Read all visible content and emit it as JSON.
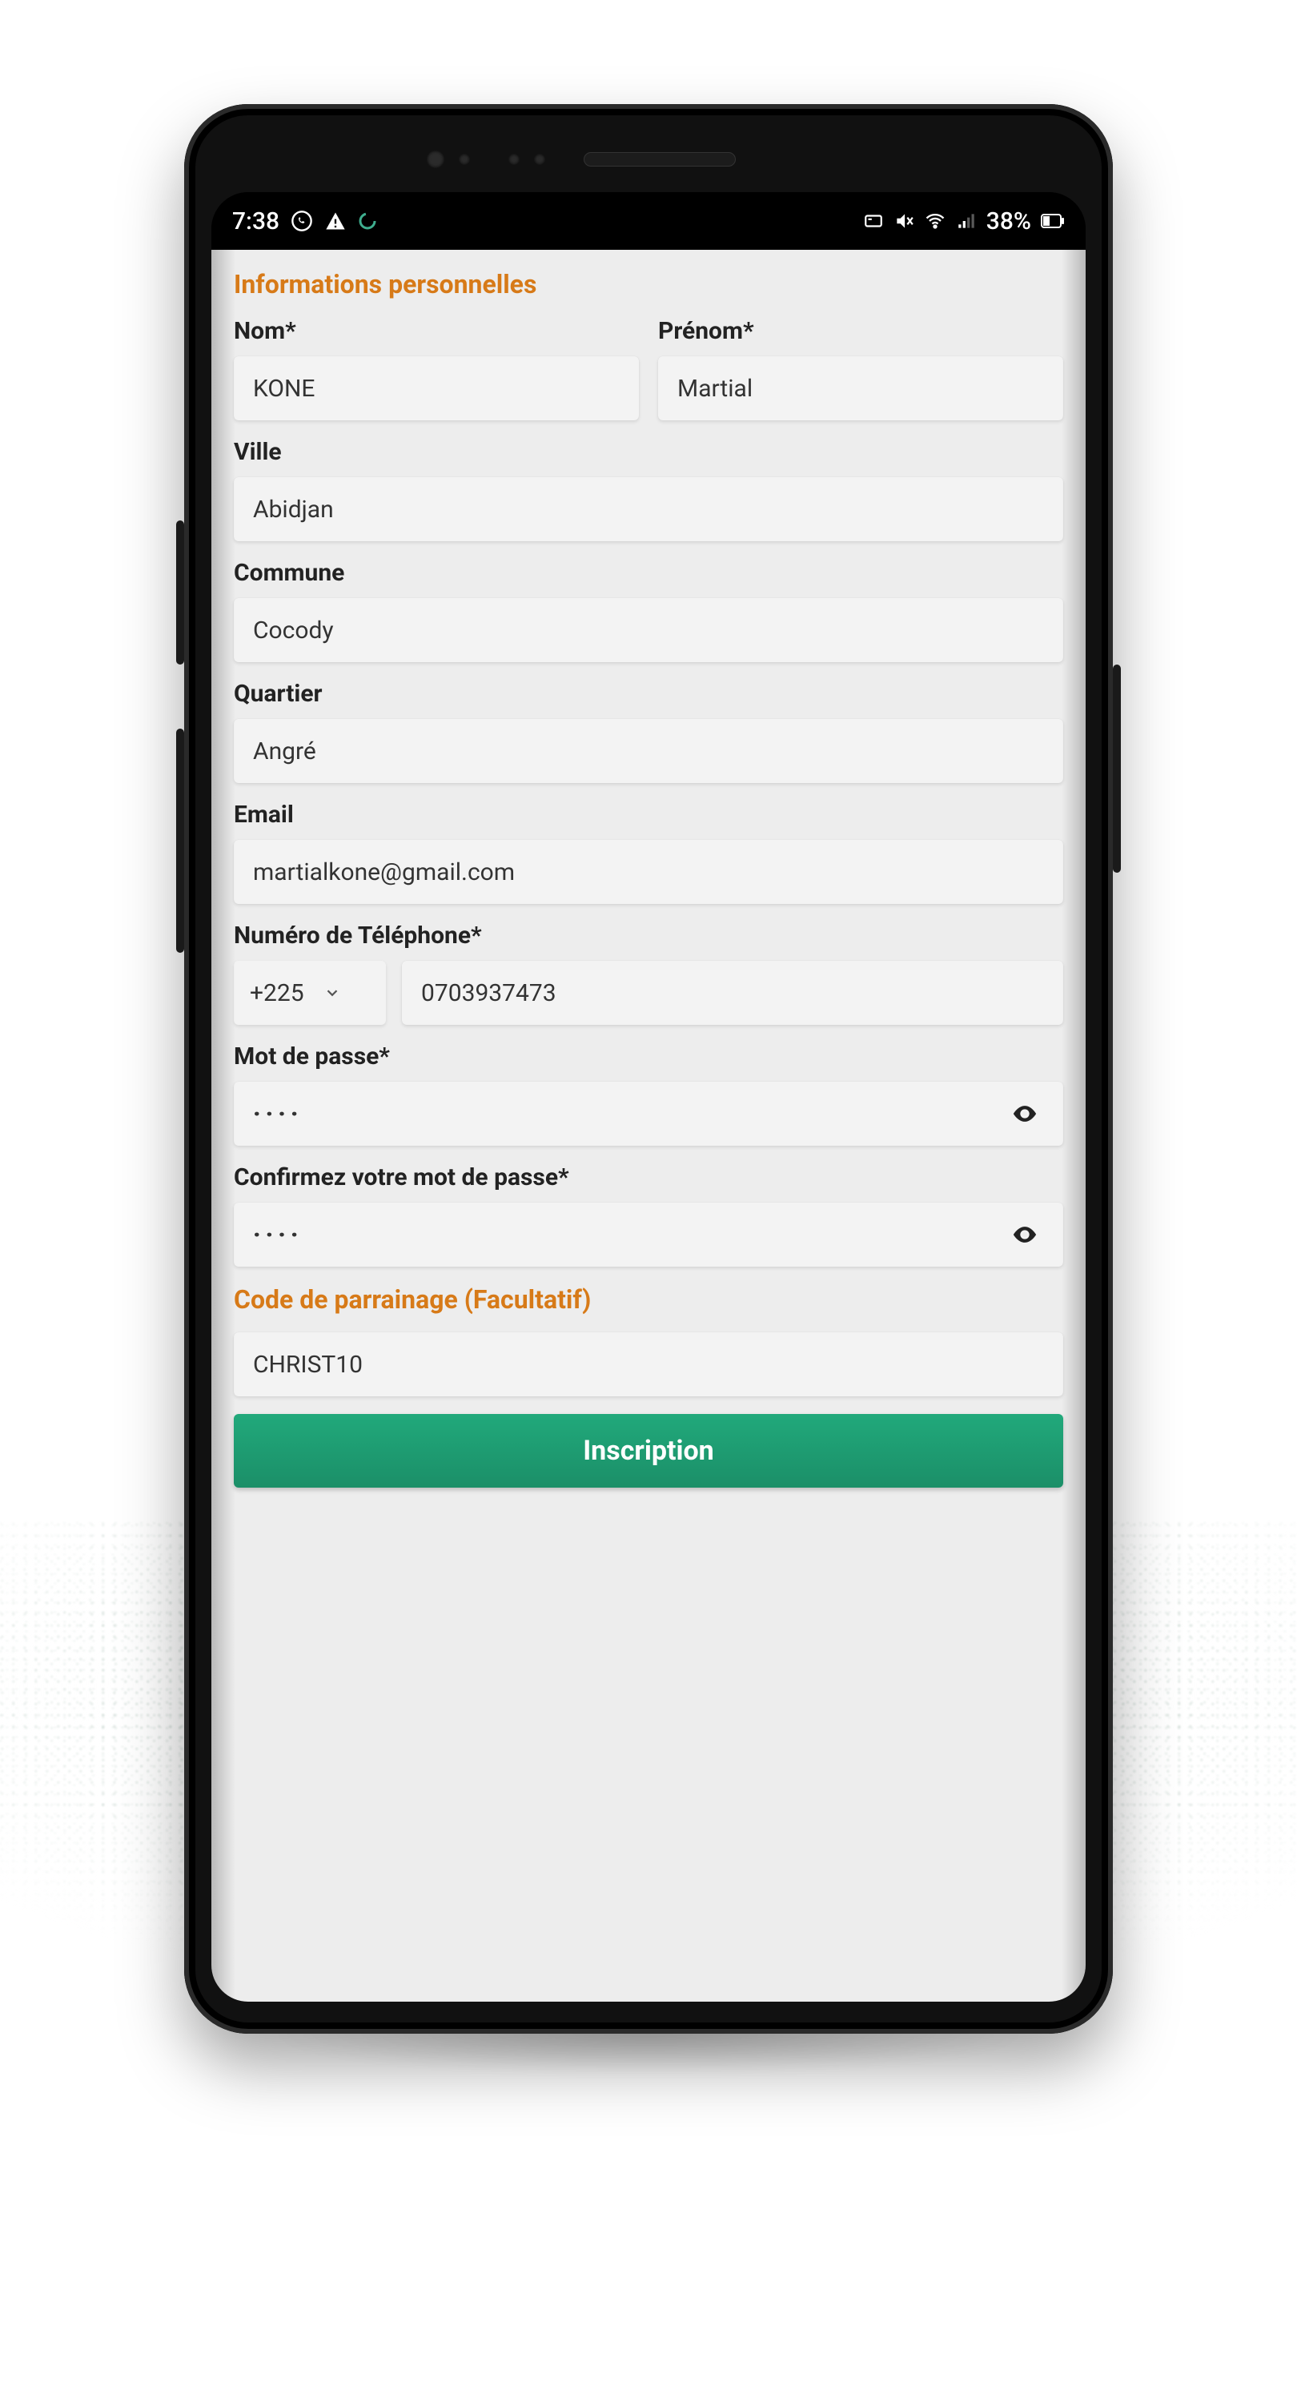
{
  "status": {
    "time": "7:38",
    "battery_text": "38%"
  },
  "sections": {
    "personal_title": "Informations personnelles",
    "referral_title": "Code de parrainage (Facultatif)"
  },
  "labels": {
    "nom": "Nom*",
    "prenom": "Prénom*",
    "ville": "Ville",
    "commune": "Commune",
    "quartier": "Quartier",
    "email": "Email",
    "telephone": "Numéro de Téléphone*",
    "mdp": "Mot de passe*",
    "mdp_confirm": "Confirmez votre mot de passe*"
  },
  "values": {
    "nom": "KONE",
    "prenom": "Martial",
    "ville": "Abidjan",
    "commune": "Cocody",
    "quartier": "Angré",
    "email": "martialkone@gmail.com",
    "country_code": "+225",
    "phone": "0703937473",
    "mdp_mask": "····",
    "mdp_confirm_mask": "····",
    "referral": "CHRIST10"
  },
  "submit_label": "Inscription"
}
